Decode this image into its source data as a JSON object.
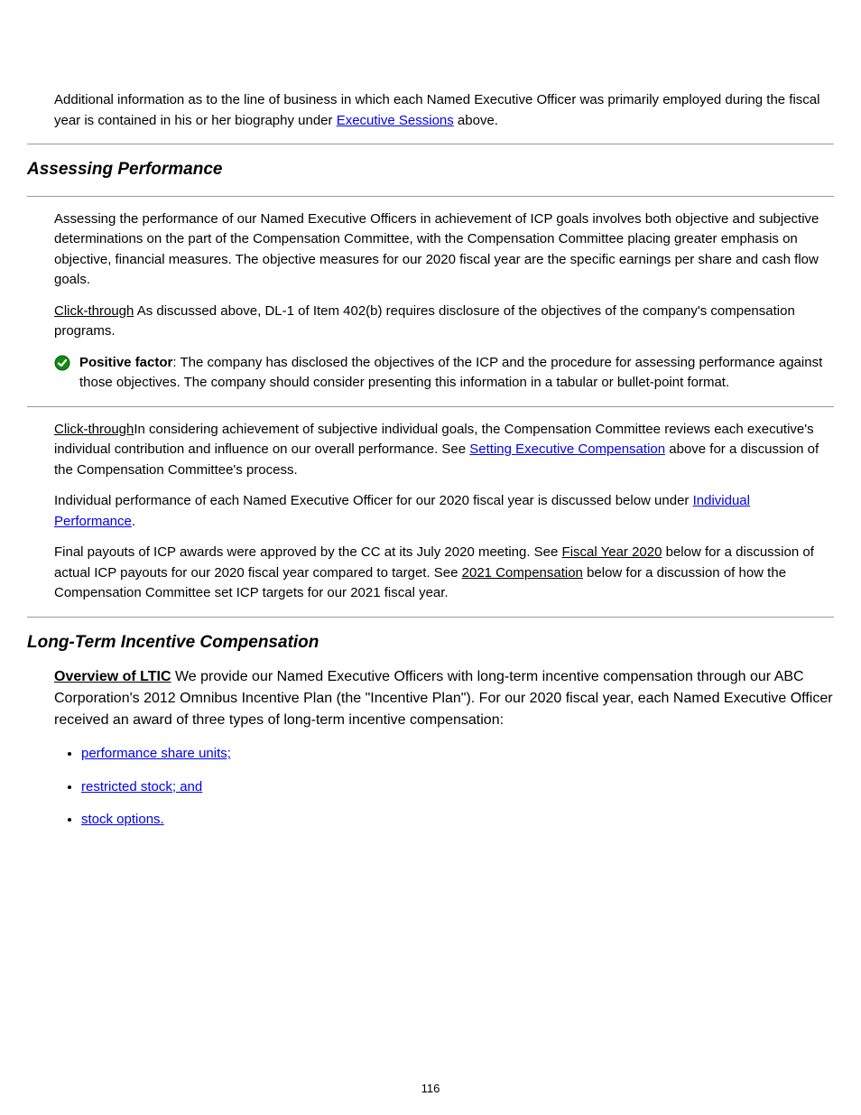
{
  "intro": {
    "p1a": "Additional information as to the line of business in which each Named Executive Officer was primarily employed during the fiscal year is contained in his or her biography under ",
    "link": "Executive Sessions",
    "p1b": " above."
  },
  "heading1": "Assessing Performance",
  "dl1": {
    "p1": "Assessing the performance of our Named Executive Officers in achievement of ICP goals involves both objective and subjective determinations on the part of the Compensation Committee, with the Compensation Committee placing greater emphasis on objective, financial measures. The objective measures for our 2020 fiscal year are the specific earnings per share and cash flow goals.",
    "tab_label": "Click-through",
    "tab_text": "  As discussed above, DL-1 of Item 402(b) requires disclosure of the objectives of the company's compensation programs.",
    "pos_label": "Positive factor",
    "pos_text": ":  The company has disclosed the objectives of the ICP and the procedure for assessing performance against those objectives.  The company should consider presenting this information in a tabular or bullet-point format."
  },
  "dl2": {
    "p1": "In considering achievement of subjective individual goals, the Compensation Committee reviews each executive's individual contribution and influence on our overall performance. See ",
    "link1": "Setting Executive Compensation",
    "p1b": " above for a discussion of the Compensation Committee's process.",
    "p2": "Individual performance of each Named Executive Officer for our 2020 fiscal year is discussed below under ",
    "link2": "Individual Performance",
    "p2b": ".",
    "p3": "Final payouts of ICP awards were approved by the CC at its July 2020 meeting. See ",
    "uline1": "Fiscal Year 2020",
    "p3b": " below for a discussion of actual ICP payouts for our 2020 fiscal year compared to target. See ",
    "uline2": "2021 Compensation",
    "p3c": " below for a discussion of how the Compensation Committee set ICP targets for our 2021 fiscal year."
  },
  "heading2": "Long-Term Incentive Compensation",
  "overview_label": "Overview of LTIC",
  "overview_text": "  We provide our Named Executive Officers with long-term incentive compensation through our ABC Corporation's 2012 Omnibus Incentive Plan (the \"Incentive Plan\"). For our 2020 fiscal year, each Named Executive Officer received an award of three types of long-term incentive compensation:",
  "bullets": {
    "b1": "performance share units;",
    "b2": "restricted stock; and",
    "b3": "stock options."
  },
  "pageNumber": "116"
}
